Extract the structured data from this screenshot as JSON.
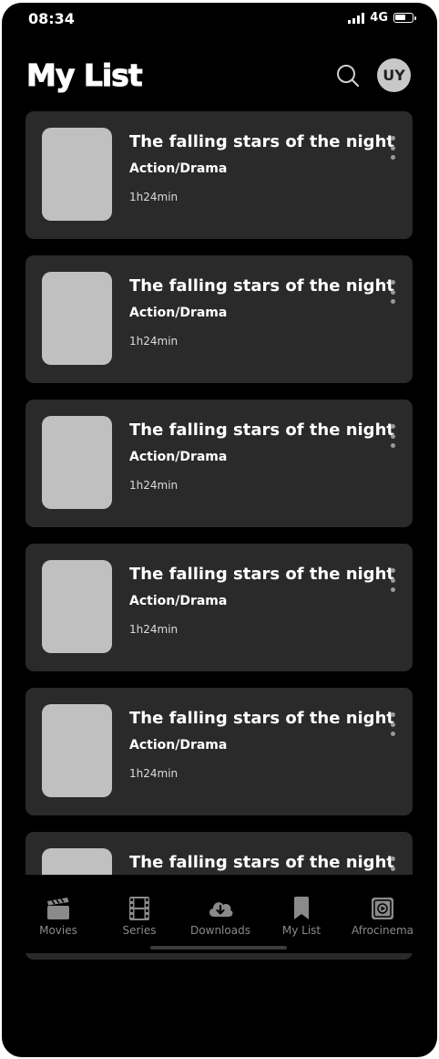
{
  "status": {
    "time": "08:34",
    "network": "4G"
  },
  "header": {
    "title": "My List",
    "avatar_initials": "UY"
  },
  "items": [
    {
      "title": "The falling stars of the night",
      "genre": "Action/Drama",
      "duration": "1h24min"
    },
    {
      "title": "The falling stars of the night",
      "genre": "Action/Drama",
      "duration": "1h24min"
    },
    {
      "title": "The falling stars of the night",
      "genre": "Action/Drama",
      "duration": "1h24min"
    },
    {
      "title": "The falling stars of the night",
      "genre": "Action/Drama",
      "duration": "1h24min"
    },
    {
      "title": "The falling stars of the night",
      "genre": "Action/Drama",
      "duration": "1h24min"
    },
    {
      "title": "The falling stars of the night",
      "genre": "",
      "duration": ""
    }
  ],
  "nav": [
    {
      "label": "Movies",
      "icon": "clapperboard-icon"
    },
    {
      "label": "Series",
      "icon": "film-strip-icon"
    },
    {
      "label": "Downloads",
      "icon": "download-cloud-icon"
    },
    {
      "label": "My List",
      "icon": "bookmark-icon"
    },
    {
      "label": "Afrocinema",
      "icon": "play-screen-icon"
    }
  ],
  "colors": {
    "background": "#000000",
    "card": "#2a2a2a",
    "thumbnail": "#c0c0c0",
    "nav_inactive": "#8a8a8a"
  }
}
